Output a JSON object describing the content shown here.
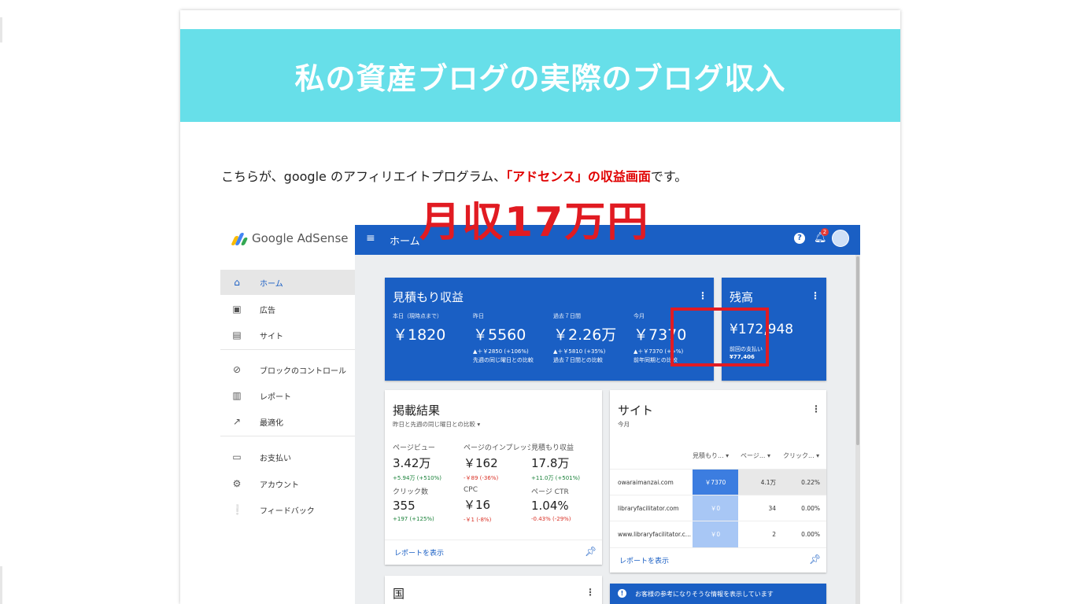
{
  "article": {
    "heading": "私の資産ブログの実際のブログ収入",
    "intro_prefix": "こちらが、google のアフィリエイトプログラム、",
    "intro_highlight": "「アドセンス」の収益画面",
    "intro_suffix": "です。"
  },
  "adsense": {
    "logo_text": "Google AdSense",
    "topbar": {
      "title": "ホーム",
      "help": "?",
      "notification_count": "2"
    },
    "nav": [
      {
        "label": "ホーム",
        "icon": "home-icon",
        "active": true
      },
      {
        "label": "広告",
        "icon": "ads-icon"
      },
      {
        "label": "サイト",
        "icon": "sites-icon"
      },
      {
        "label": "ブロックのコントロール",
        "icon": "block-icon"
      },
      {
        "label": "レポート",
        "icon": "reports-icon"
      },
      {
        "label": "最適化",
        "icon": "optimize-icon"
      },
      {
        "label": "お支払い",
        "icon": "payments-icon"
      },
      {
        "label": "アカウント",
        "icon": "account-icon"
      },
      {
        "label": "フィードバック",
        "icon": "feedback-icon"
      }
    ],
    "estimated": {
      "title": "見積もり収益",
      "items": [
        {
          "label": "本日（現時点まで）",
          "value": "￥1820",
          "sub1": "",
          "sub2": ""
        },
        {
          "label": "昨日",
          "value": "￥5560",
          "sub1": "▲＋￥2850 (+106%)",
          "sub2": "先週の同じ曜日との比較"
        },
        {
          "label": "過去７日間",
          "value": "￥2.26万",
          "sub1": "▲＋￥5810 (+35%)",
          "sub2": "過去７日間との比較"
        },
        {
          "label": "今月",
          "value": "￥7370",
          "sub1": "▲＋￥7370 (+∞%)",
          "sub2": "前年同期との比較"
        }
      ]
    },
    "balance": {
      "title": "残高",
      "value": "¥172,948",
      "label": "前回の支払い",
      "last_payment": "¥77,406"
    },
    "performance": {
      "title": "掲載結果",
      "subtitle": "昨日と先週の同じ曜日との比較",
      "metrics": [
        {
          "label": "ページビュー",
          "value": "3.42万",
          "delta": "+5.94万 (+510%)",
          "pos": true
        },
        {
          "label": "ページのインプレッション収益",
          "value": "￥162",
          "delta": "-￥89 (-36%)",
          "pos": false
        },
        {
          "label": "見積もり収益",
          "value": "17.8万",
          "delta": "+11.0万 (+501%)",
          "pos": true
        },
        {
          "label": "クリック数",
          "value": "355",
          "delta": "+197 (+125%)",
          "pos": true
        },
        {
          "label": "CPC",
          "value": "￥16",
          "delta": "-￥1 (-8%)",
          "pos": false
        },
        {
          "label": "ページ CTR",
          "value": "1.04%",
          "delta": "-0.43% (-29%)",
          "pos": false
        }
      ],
      "link": "レポートを表示"
    },
    "sites": {
      "title": "サイト",
      "sub": "今月",
      "columns": [
        "見積もり...",
        "ページ...",
        "クリック..."
      ],
      "rows": [
        {
          "name": "owaraimanzai.com",
          "c1": "￥7370",
          "c2": "4.1万",
          "c3": "0.22%",
          "strong": true
        },
        {
          "name": "libraryfacilitator.com",
          "c1": "￥0",
          "c2": "34",
          "c3": "0.00%",
          "strong": false
        },
        {
          "name": "www.libraryfacilitator.c...",
          "c1": "￥0",
          "c2": "2",
          "c3": "0.00%",
          "strong": false
        }
      ],
      "link": "レポートを表示"
    },
    "country_title": "国",
    "info_banner": "お客様の参考になりそうな情報を表示しています"
  },
  "overlay_text": "月収17万円",
  "colors": {
    "banner": "#67dfe9",
    "adsense_blue": "#1a5fc4",
    "highlight_red": "#e11b22"
  }
}
